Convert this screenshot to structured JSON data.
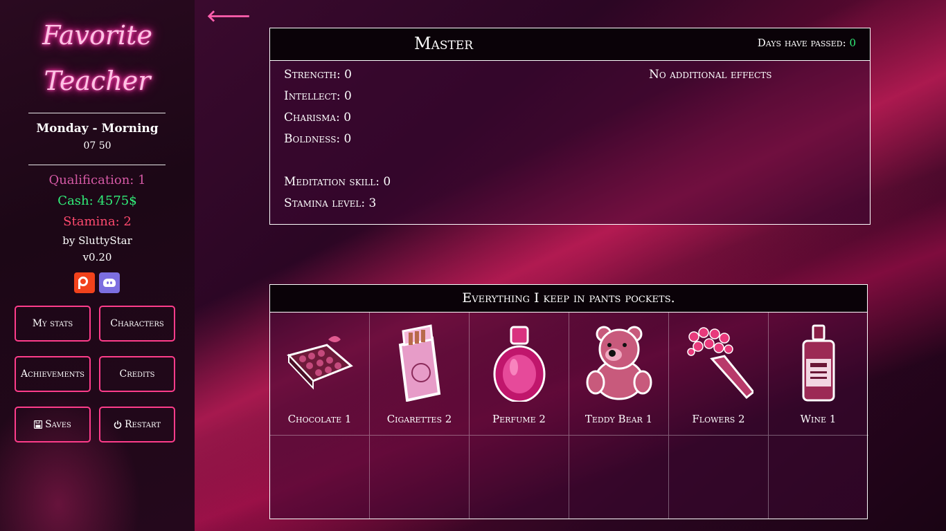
{
  "sidebar": {
    "logo_line1": "Favorite",
    "logo_line2": "Teacher",
    "day": "Monday - Morning",
    "time": "07 50",
    "qualification": "Qualification: 1",
    "cash": "Cash: 4575$",
    "stamina": "Stamina: 2",
    "author": "by SluttyStar",
    "version": "v0.20",
    "buttons": {
      "my_stats": "My stats",
      "characters": "Characters",
      "achievements": "Achievements",
      "credits": "Credits",
      "saves": "Saves",
      "restart": "Restart"
    }
  },
  "stats_panel": {
    "title": "Master",
    "days_label": "Days have passed: ",
    "days_value": "0",
    "stats": [
      "Strength: 0",
      "Intellect: 0",
      "Charisma: 0",
      "Boldness: 0",
      "Meditation skill: 0",
      "Stamina level: 3"
    ],
    "effects": "No additional effects"
  },
  "inventory": {
    "title": "Everything I keep in pants pockets.",
    "items": [
      {
        "label": "Chocolate 1",
        "icon": "chocolate-box-icon"
      },
      {
        "label": "Cigarettes 2",
        "icon": "cigarette-pack-icon"
      },
      {
        "label": "Perfume 2",
        "icon": "perfume-bottle-icon"
      },
      {
        "label": "Teddy Bear 1",
        "icon": "teddy-bear-icon"
      },
      {
        "label": "Flowers 2",
        "icon": "flower-bouquet-icon"
      },
      {
        "label": "Wine 1",
        "icon": "whiskey-bottle-icon"
      }
    ]
  },
  "colors": {
    "accent": "#ff3d8b",
    "cash": "#31f07a",
    "stamina": "#ff4a6e",
    "qualification": "#d65aa6"
  }
}
